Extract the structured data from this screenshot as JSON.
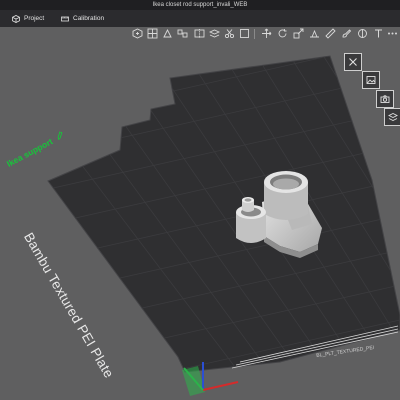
{
  "window": {
    "title": "Ikea closet rod support_invali_WEB"
  },
  "tabs": [
    {
      "label": "Project",
      "icon": "cube-icon"
    },
    {
      "label": "Calibration",
      "icon": "ruler-icon"
    }
  ],
  "toolbar": {
    "icons": [
      "add-object-icon",
      "grid-layout-icon",
      "orient-icon",
      "arrange-icon",
      "split-icon",
      "layers-icon",
      "cut-icon",
      "separator",
      "move-icon",
      "rotate-icon",
      "scale-icon",
      "place-on-face-icon",
      "measure-icon",
      "paint-icon",
      "seam-icon",
      "text-icon",
      "assemble-icon",
      "more-icon"
    ]
  },
  "side_toolbar": {
    "icons": [
      "close-view-icon",
      "image-view-icon",
      "camera-icon",
      "layers-view-icon"
    ]
  },
  "plate": {
    "name": "Bambu Textured PEI Plate",
    "tag": "Ikea support",
    "code": "BL_PLT_TEXTURED_PEI"
  },
  "colors": {
    "background": "#5f5f60",
    "plate": "#2f2f31",
    "grid": "#3c3c3e",
    "model": "#c9c9c9",
    "accent_green": "#17c53a",
    "axis_x": "#d42b2b",
    "axis_y": "#2bb34a",
    "axis_z": "#2b4fd4"
  }
}
